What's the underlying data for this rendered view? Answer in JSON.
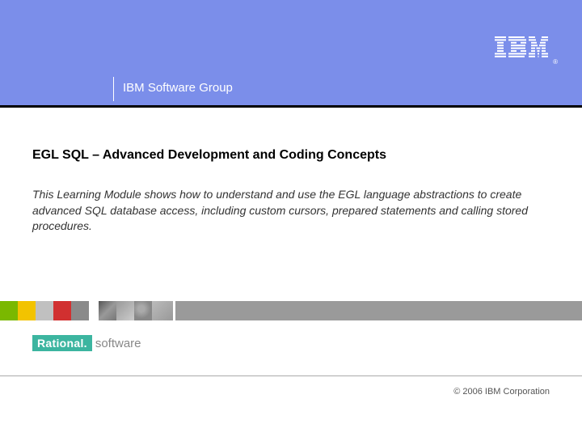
{
  "header": {
    "subtitle": "IBM Software Group",
    "logo_name": "IBM"
  },
  "content": {
    "title": "EGL SQL – Advanced Development and Coding Concepts",
    "description": "This Learning Module shows how to understand and use the EGL language abstractions to create advanced SQL database access, including custom cursors, prepared statements and calling stored procedures."
  },
  "footer": {
    "brand_primary": "Rational.",
    "brand_secondary": "software",
    "copyright": "© 2006 IBM Corporation"
  }
}
